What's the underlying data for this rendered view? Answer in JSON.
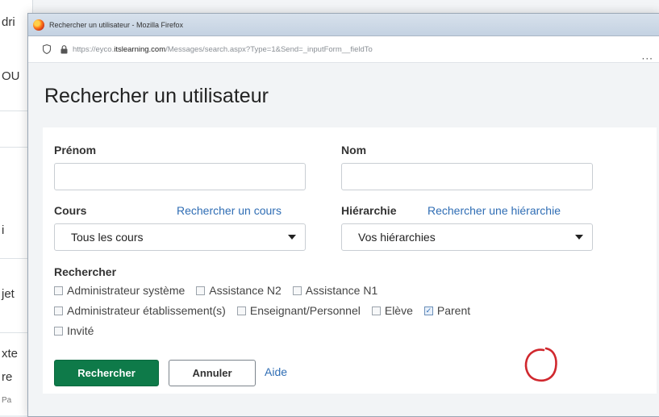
{
  "background": {
    "fragments": [
      "dri",
      "OU",
      "i",
      "jet",
      "xte",
      "re",
      "Pa"
    ]
  },
  "window": {
    "title": "Rechercher un utilisateur - Mozilla Firefox",
    "url_prefix": "https://eyco.",
    "url_host": "itslearning.com",
    "url_path": "/Messages/search.aspx?Type=1&Send=_inputForm__fieldTo",
    "more_label": "···"
  },
  "page": {
    "title": "Rechercher un utilisateur"
  },
  "form": {
    "prenom_label": "Prénom",
    "prenom_value": "",
    "nom_label": "Nom",
    "nom_value": "",
    "cours_label": "Cours",
    "cours_link": "Rechercher un cours",
    "cours_selected": "Tous les cours",
    "hierarchie_label": "Hiérarchie",
    "hierarchie_link": "Rechercher une hiérarchie",
    "hierarchie_selected": "Vos hiérarchies",
    "rechercher_label": "Rechercher",
    "roles": [
      {
        "label": "Administrateur système",
        "checked": false
      },
      {
        "label": "Assistance N2",
        "checked": false
      },
      {
        "label": "Assistance N1",
        "checked": false
      },
      {
        "label": "Administrateur établissement(s)",
        "checked": false
      },
      {
        "label": "Enseignant/Personnel",
        "checked": false
      },
      {
        "label": "Elève",
        "checked": false
      },
      {
        "label": "Parent",
        "checked": true
      },
      {
        "label": "Invité",
        "checked": false
      }
    ],
    "check_glyph": "✓",
    "search_button": "Rechercher",
    "cancel_button": "Annuler",
    "help_link": "Aide"
  },
  "colors": {
    "primary_button": "#0e7a49",
    "link": "#2f6db4",
    "annotation_circle": "#d0282e"
  }
}
